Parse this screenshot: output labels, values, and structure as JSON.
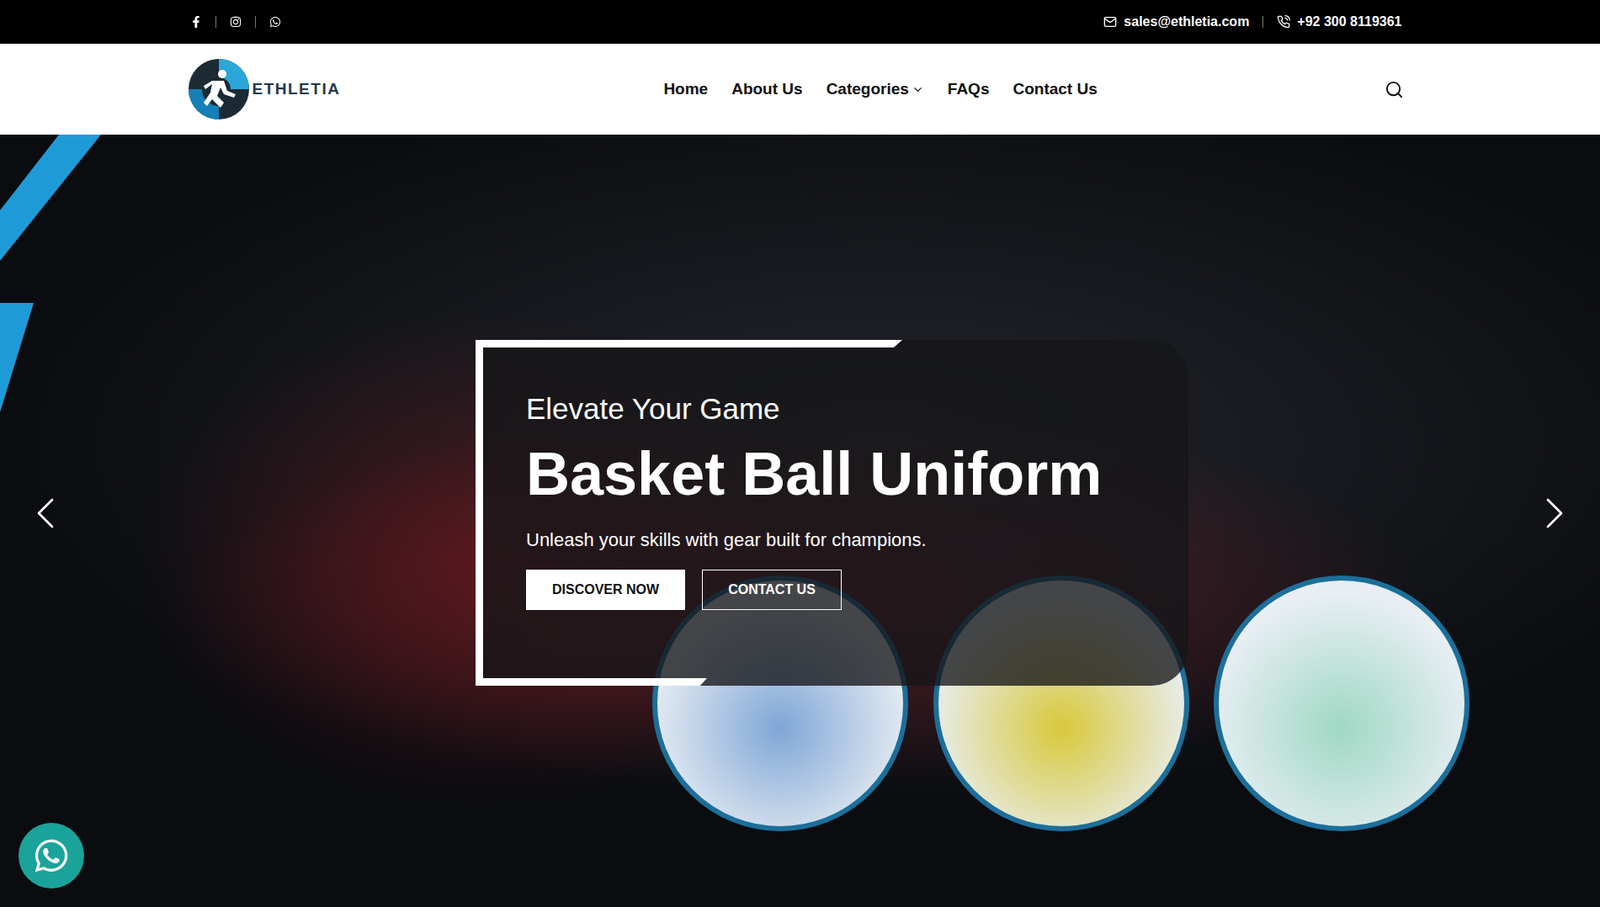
{
  "topbar": {
    "email": "sales@ethletia.com",
    "phone": "+92 300 8119361"
  },
  "logo": {
    "text": "ETHLETIA"
  },
  "nav": [
    {
      "label": "Home",
      "kind": "link"
    },
    {
      "label": "About Us",
      "kind": "link"
    },
    {
      "label": "Categories",
      "kind": "dropdown"
    },
    {
      "label": "FAQs",
      "kind": "link"
    },
    {
      "label": "Contact Us",
      "kind": "link"
    }
  ],
  "hero": {
    "eyebrow": "Elevate Your Game",
    "title": "Basket Ball Uniform",
    "subtitle": "Unleash your skills with gear built for champions.",
    "buttons": [
      {
        "label": "DISCOVER NOW",
        "kind": "filled"
      },
      {
        "label": "CONTACT US",
        "kind": "outline"
      }
    ]
  }
}
